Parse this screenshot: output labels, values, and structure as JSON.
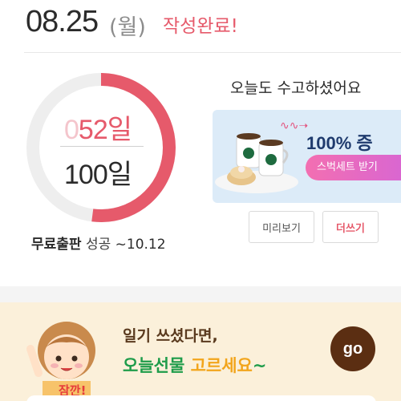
{
  "header": {
    "date": "08.25",
    "day_of_week": "(월)",
    "status": "작성완료!"
  },
  "progress": {
    "count_faded_digit": "0",
    "count": "52일",
    "total": "100일",
    "fraction": 0.52,
    "colors": {
      "fill": "#e65a6b",
      "track": "#eeeeee"
    }
  },
  "goal": {
    "label": "무료출판",
    "result": "성공",
    "date": "~10.12"
  },
  "cheer_text": "오늘도 수고하셨어요",
  "banner": {
    "headline": "100% 증",
    "pill_text": "스벅세트 받기"
  },
  "buttons": {
    "preview": "미리보기",
    "write_more": "더쓰기"
  },
  "promo": {
    "line1": "일기 쓰셨다면,",
    "line2_part1": "오늘선물",
    "line2_part2": "고르세요",
    "line2_part3": "~",
    "go": "go",
    "badge": "잠깐!"
  }
}
